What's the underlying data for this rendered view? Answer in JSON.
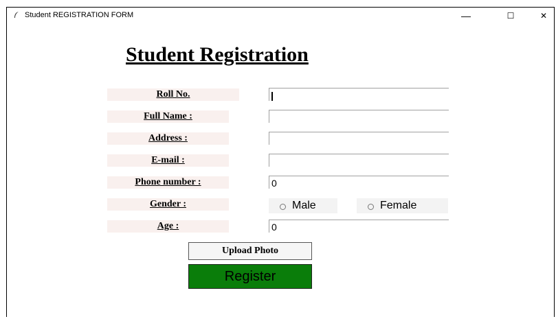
{
  "window": {
    "title": "Student REGISTRATION FORM",
    "minimize": "—",
    "maximize": "☐",
    "close": "✕"
  },
  "form": {
    "heading": "Student Registration",
    "fields": {
      "roll_label": "Roll No.",
      "roll_value": "",
      "name_label": "Full Name :",
      "name_value": "",
      "address_label": "Address :",
      "address_value": "",
      "email_label": "E-mail :",
      "email_value": "",
      "phone_label": "Phone number :",
      "phone_value": "0",
      "gender_label": "Gender :",
      "gender_male": "Male",
      "gender_female": "Female",
      "age_label": "Age :",
      "age_value": "0"
    },
    "upload_button": "Upload Photo",
    "register_button": "Register"
  },
  "colors": {
    "label_bg": "#f9f0ee",
    "register_bg": "#0a7d0a"
  },
  "icons": {
    "app": "feather-icon"
  }
}
